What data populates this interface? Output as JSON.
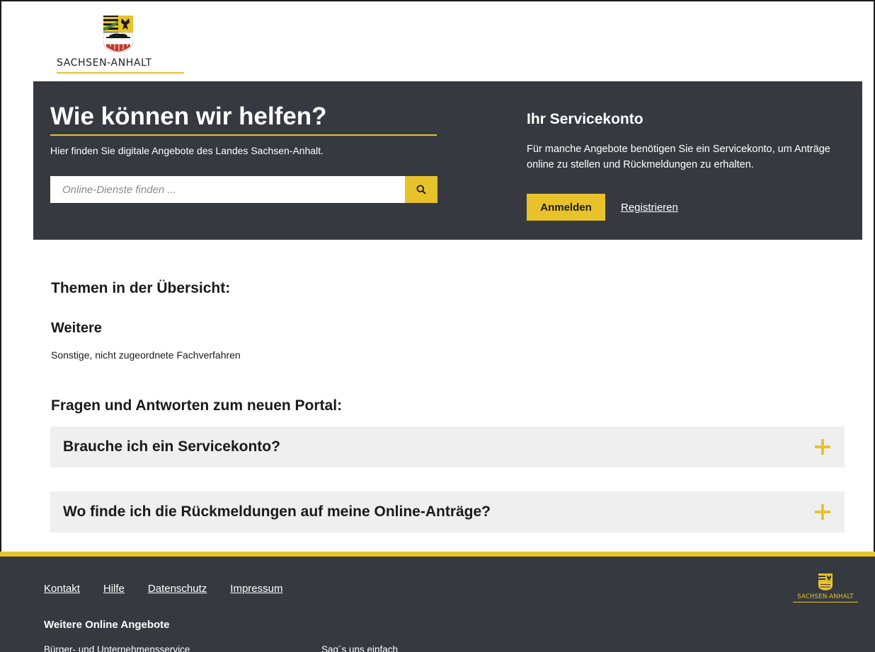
{
  "brand": {
    "name": "SACHSEN-ANHALT",
    "accent_color": "#e8c22a",
    "dark_color": "#363a40"
  },
  "hero": {
    "title": "Wie können wir helfen?",
    "subtitle": "Hier finden Sie digitale Angebote des Landes Sachsen-Anhalt.",
    "search_placeholder": "Online-Dienste finden ...",
    "search_icon": "search-icon"
  },
  "servicekonto": {
    "title": "Ihr Servicekonto",
    "text": "Für manche Angebote benötigen Sie ein Servicekonto, um Anträge online zu stellen und Rückmeldungen zu erhalten.",
    "login_label": "Anmelden",
    "register_label": "Registrieren"
  },
  "topics": {
    "heading": "Themen in der Übersicht:",
    "items": [
      {
        "name": "Weitere",
        "description": "Sonstige, nicht zugeordnete Fachverfahren"
      }
    ]
  },
  "faq": {
    "heading": "Fragen und Antworten zum neuen Portal:",
    "items": [
      {
        "question": "Brauche ich ein Servicekonto?",
        "icon": "plus-icon"
      },
      {
        "question": "Wo finde ich die Rückmeldungen auf meine Online-Anträge?",
        "icon": "plus-icon"
      }
    ]
  },
  "footer": {
    "links": [
      {
        "label": "Kontakt"
      },
      {
        "label": "Hilfe"
      },
      {
        "label": "Datenschutz"
      },
      {
        "label": "Impressum"
      }
    ],
    "heading": "Weitere Online Angebote",
    "more_links": [
      {
        "label": "Bürger- und Unternehmensservice"
      },
      {
        "label": "Sag´s uns einfach"
      }
    ],
    "logo_text": "SACHSEN-ANHALT"
  }
}
